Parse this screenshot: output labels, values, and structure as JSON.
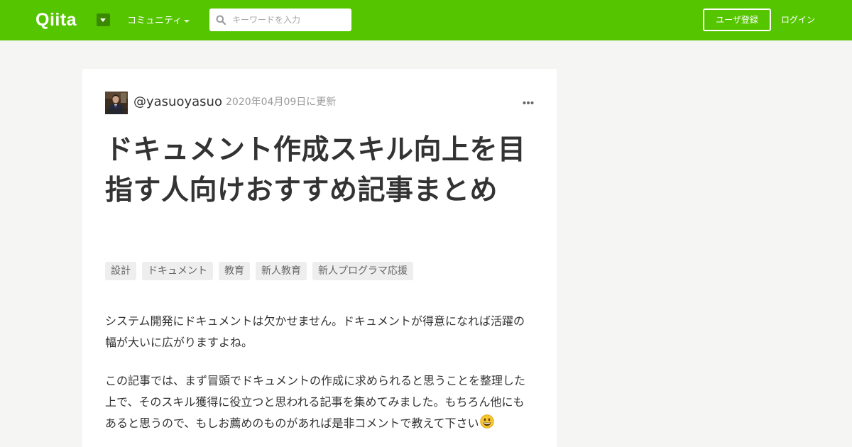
{
  "header": {
    "logo": "Qiita",
    "community_label": "コミュニティ",
    "search_placeholder": "キーワードを入力",
    "search_value": "",
    "signup_label": "ユーザ登録",
    "login_label": "ログイン",
    "brand_color": "#55c500"
  },
  "article": {
    "author": "@yasuoyasuo",
    "updated": "2020年04月09日に更新",
    "title": "ドキュメント作成スキル向上を目指す人向けおすすめ記事まとめ",
    "tags": [
      "設計",
      "ドキュメント",
      "教育",
      "新人教育",
      "新人プログラマ応援"
    ],
    "paragraphs": [
      "システム開発にドキュメントは欠かせません。ドキュメントが得意になれば活躍の幅が大いに広がりますよね。",
      "この記事では、まず冒頭でドキュメントの作成に求められると思うことを整理した上で、そのスキル獲得に役立つと思われる記事を集めてみました。もちろん他にもあると思うので、もしお薦めのものがあれば是非コメントで教えて下さい"
    ],
    "emoji": "grinning-face"
  }
}
